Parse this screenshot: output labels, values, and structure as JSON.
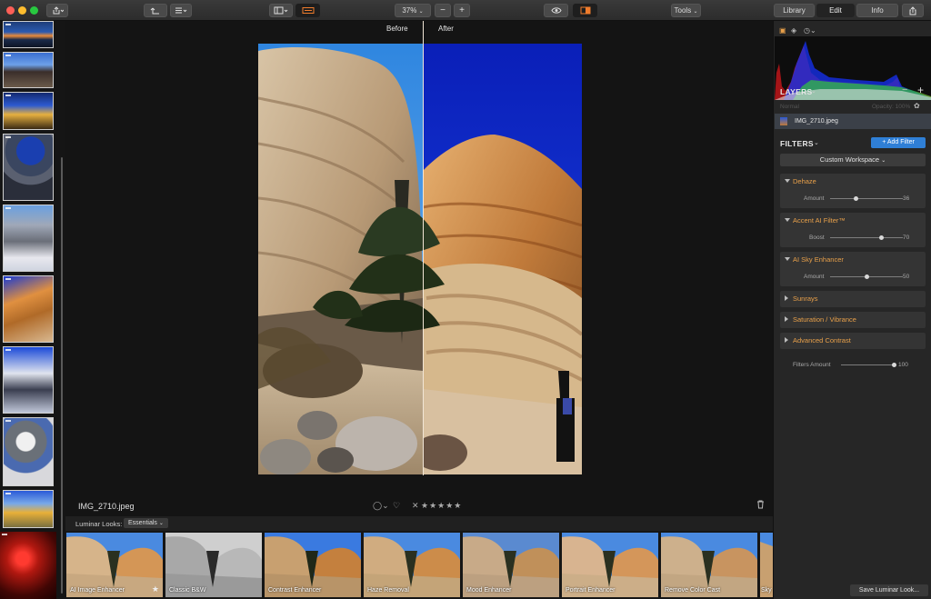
{
  "toolbar": {
    "zoom": "37%",
    "tools_label": "Tools",
    "tabs": [
      "Library",
      "Edit",
      "Info"
    ],
    "active_tab": "Edit"
  },
  "canvas": {
    "before_label": "Before",
    "after_label": "After",
    "filename": "IMG_2710.jpeg"
  },
  "looks_bar": {
    "label": "Luminar Looks:",
    "category": "Essentials"
  },
  "looks": [
    "AI Image Enhancer",
    "Classic B&W",
    "Contrast Enhancer",
    "Haze Removal",
    "Mood Enhancer",
    "Portrait Enhancer",
    "Remove Color Cast",
    "Sky"
  ],
  "layers": {
    "title": "LAYERS",
    "blend_mode": "Normal",
    "opacity_label": "Opacity: 100%",
    "layer_name": "IMG_2710.jpeg"
  },
  "filters": {
    "title": "FILTERS",
    "add_label": "+ Add Filter",
    "workspace": "Custom Workspace",
    "items": [
      {
        "name": "Dehaze",
        "expanded": true,
        "slider": {
          "label": "Amount",
          "value": "36",
          "fraction": 0.36
        }
      },
      {
        "name": "Accent AI Filter™",
        "expanded": true,
        "slider": {
          "label": "Boost",
          "value": "70",
          "fraction": 0.7
        }
      },
      {
        "name": "AI Sky Enhancer",
        "expanded": true,
        "slider": {
          "label": "Amount",
          "value": "50",
          "fraction": 0.5
        }
      },
      {
        "name": "Sunrays",
        "expanded": false
      },
      {
        "name": "Saturation / Vibrance",
        "expanded": false
      },
      {
        "name": "Advanced Contrast",
        "expanded": false
      }
    ],
    "filters_amount": {
      "label": "Filters Amount",
      "value": "100",
      "fraction": 1.0
    }
  },
  "save_look_label": "Save Luminar Look...",
  "colors": {
    "accent": "#e8a04a",
    "primary_button": "#2f7fd6"
  }
}
